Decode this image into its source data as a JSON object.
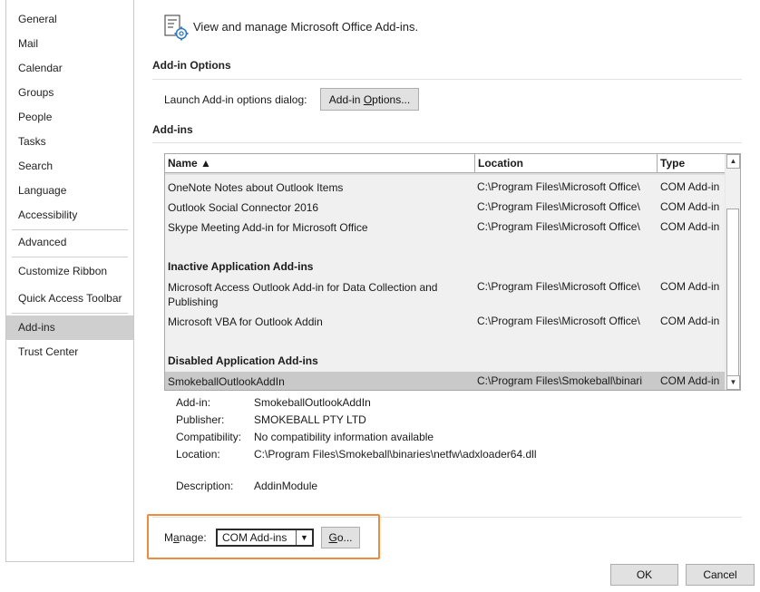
{
  "sidebar": {
    "items": [
      {
        "label": "General"
      },
      {
        "label": "Mail"
      },
      {
        "label": "Calendar"
      },
      {
        "label": "Groups"
      },
      {
        "label": "People"
      },
      {
        "label": "Tasks"
      },
      {
        "label": "Search"
      },
      {
        "label": "Language"
      },
      {
        "label": "Accessibility"
      },
      {
        "label": "Advanced"
      },
      {
        "label": "Customize Ribbon"
      },
      {
        "label": "Quick Access Toolbar"
      },
      {
        "label": "Add-ins"
      },
      {
        "label": "Trust Center"
      }
    ],
    "selected": "Add-ins"
  },
  "header": {
    "icon": "addins-gear-icon",
    "text": "View and manage Microsoft Office Add-ins."
  },
  "addin_options": {
    "title": "Add-in Options",
    "launch_label": "Launch Add-in options dialog:",
    "button_pre": "Add-in ",
    "button_ul": "O",
    "button_post": "ptions..."
  },
  "addins": {
    "title": "Add-ins",
    "columns": {
      "name": "Name ▲",
      "location": "Location",
      "type": "Type"
    },
    "rows": [
      {
        "name": "OneNote Notes about Outlook Items",
        "location": "C:\\Program Files\\Microsoft Office\\",
        "type": "COM Add-in"
      },
      {
        "name": "Outlook Social Connector 2016",
        "location": "C:\\Program Files\\Microsoft Office\\",
        "type": "COM Add-in"
      },
      {
        "name": "Skype Meeting Add-in for Microsoft Office",
        "location": "C:\\Program Files\\Microsoft Office\\",
        "type": "COM Add-in"
      }
    ],
    "inactive_title": "Inactive Application Add-ins",
    "inactive_rows": [
      {
        "name": "Microsoft Access Outlook Add-in for Data Collection and Publishing",
        "location": "C:\\Program Files\\Microsoft Office\\",
        "type": "COM Add-in"
      },
      {
        "name": "Microsoft VBA for Outlook Addin",
        "location": "C:\\Program Files\\Microsoft Office\\",
        "type": "COM Add-in"
      }
    ],
    "disabled_title": "Disabled Application Add-ins",
    "disabled_rows": [
      {
        "name": "SmokeballOutlookAddIn",
        "location": "C:\\Program Files\\Smokeball\\binari",
        "type": "COM Add-in"
      }
    ]
  },
  "details": {
    "addin_label": "Add-in:",
    "addin_value": "SmokeballOutlookAddIn",
    "publisher_label": "Publisher:",
    "publisher_value": "SMOKEBALL PTY LTD",
    "compat_label": "Compatibility:",
    "compat_value": "No compatibility information available",
    "location_label": "Location:",
    "location_value": "C:\\Program Files\\Smokeball\\binaries\\netfw\\adxloader64.dll",
    "description_label": "Description:",
    "description_value": "AddinModule"
  },
  "manage": {
    "label_pre": "M",
    "label_ul": "a",
    "label_post": "nage:",
    "selected": "COM Add-ins",
    "go_ul": "G",
    "go_post": "o..."
  },
  "footer": {
    "ok": "OK",
    "cancel": "Cancel"
  },
  "colors": {
    "highlight_box": "#ee8a3e",
    "selected_bg": "#cfcfcf"
  }
}
